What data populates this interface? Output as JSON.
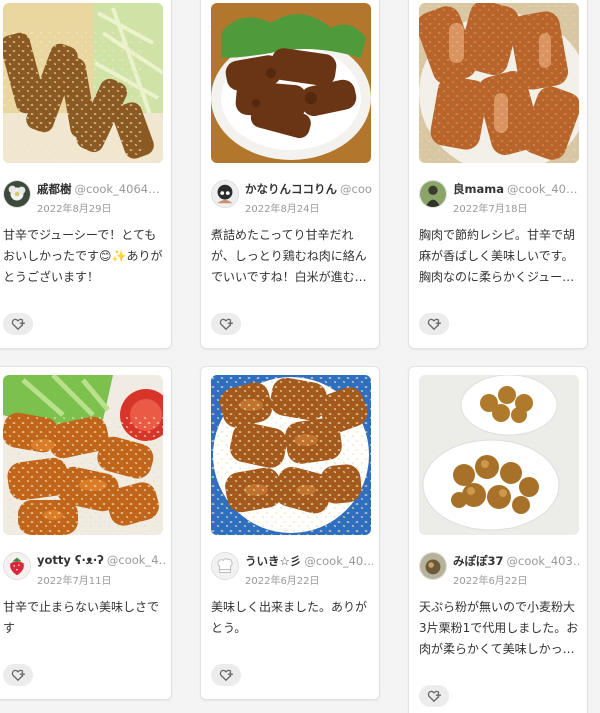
{
  "colors": {
    "page_bg": "#f4f4f4",
    "card_bg": "#ffffff",
    "text": "#333333",
    "muted": "#999999",
    "like_bg": "#ececec"
  },
  "cards": [
    {
      "user": "戚都樹",
      "id": "@cook_4064…",
      "date": "2022年8月29日",
      "comment": "甘辛でジューシーで！とてもおいしかったです😊✨ありがとうございます！",
      "avatar_icon": "flower-avatar-icon",
      "like_icon": "heart-plus-icon"
    },
    {
      "user": "かなりんココりん",
      "id": "@coo…",
      "date": "2022年8月24日",
      "comment": "煮詰めたこってり甘辛だれが、しっとり鶏むね肉に絡んでいいですね！白米が進むお味、…",
      "avatar_icon": "character-avatar-icon",
      "like_icon": "heart-plus-icon"
    },
    {
      "user": "良mama",
      "id": "@cook_40…",
      "date": "2022年7月18日",
      "comment": "胸肉で節約レシピ。甘辛で胡麻が香ばしく美味しいです。胸肉なのに柔らかくジューシ…",
      "avatar_icon": "person-avatar-icon",
      "like_icon": "heart-plus-icon"
    },
    {
      "user": "yotty ʕ·ᴥ·ʔ",
      "id": "@cook_4…",
      "date": "2022年7月11日",
      "comment": "甘辛で止まらない美味しさです",
      "avatar_icon": "strawberry-avatar-icon",
      "like_icon": "heart-plus-icon"
    },
    {
      "user": "ういき☆彡",
      "id": "@cook_40…",
      "date": "2022年6月22日",
      "comment": "美味しく出来ました。ありがとう。",
      "avatar_icon": "chef-hat-avatar-icon",
      "like_icon": "heart-plus-icon"
    },
    {
      "user": "みぽぽ37",
      "id": "@cook_403…",
      "date": "2022年6月22日",
      "comment": "天ぷら粉が無いので小麦粉大3片栗粉1で代用しました。お肉が柔らかくて美味しかっ…",
      "avatar_icon": "photo-avatar-icon",
      "like_icon": "heart-plus-icon"
    }
  ]
}
